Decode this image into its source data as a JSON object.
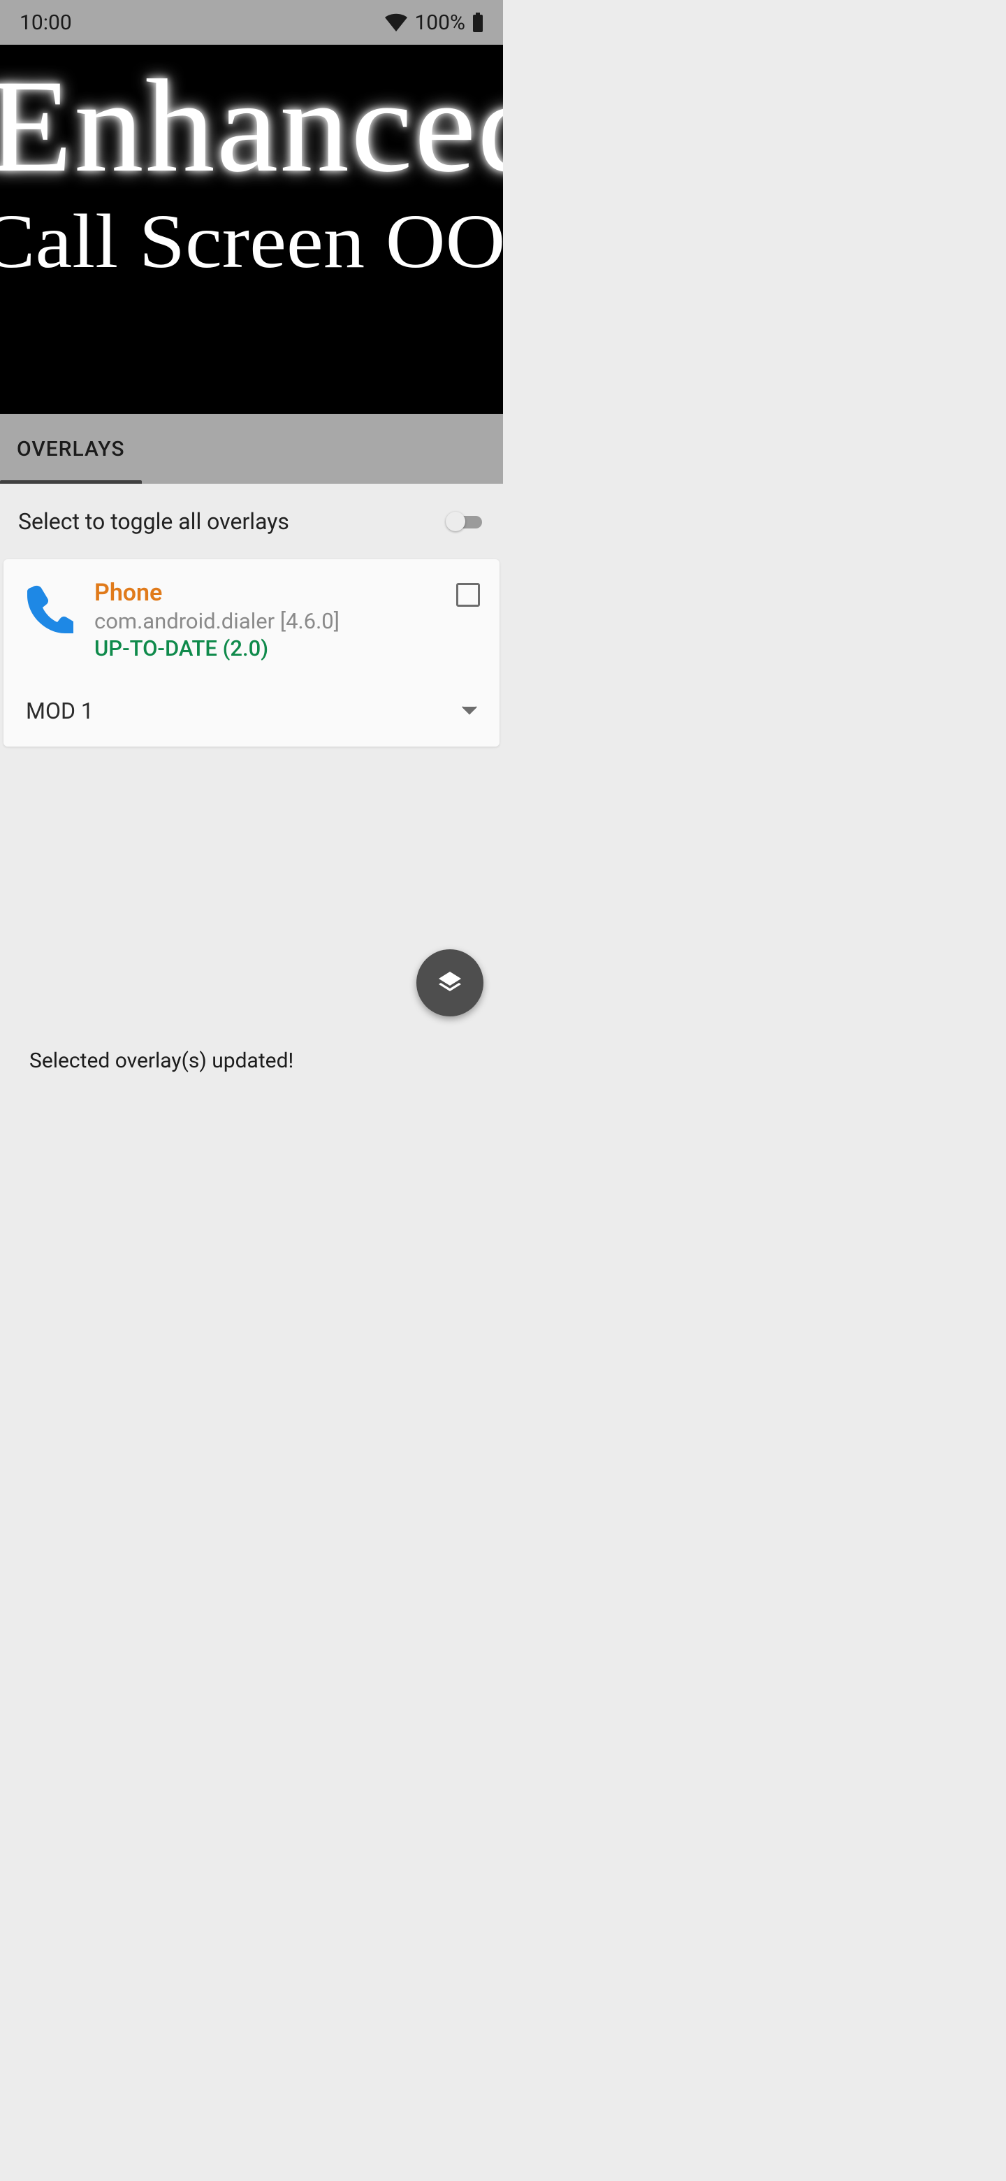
{
  "status_bar": {
    "time": "10:00",
    "battery_pct": "100%"
  },
  "hero": {
    "line1": "Enhanced",
    "line2": "Call Screen OOS"
  },
  "tabs": {
    "overlays": "OVERLAYS"
  },
  "toggle_row": {
    "label": "Select to toggle all overlays"
  },
  "overlay_item": {
    "app_name": "Phone",
    "package_line": "com.android.dialer [4.6.0]",
    "status": "UP-TO-DATE (2.0)",
    "mod_label": "MOD 1"
  },
  "snackbar": {
    "text": "Selected overlay(s) updated!"
  }
}
